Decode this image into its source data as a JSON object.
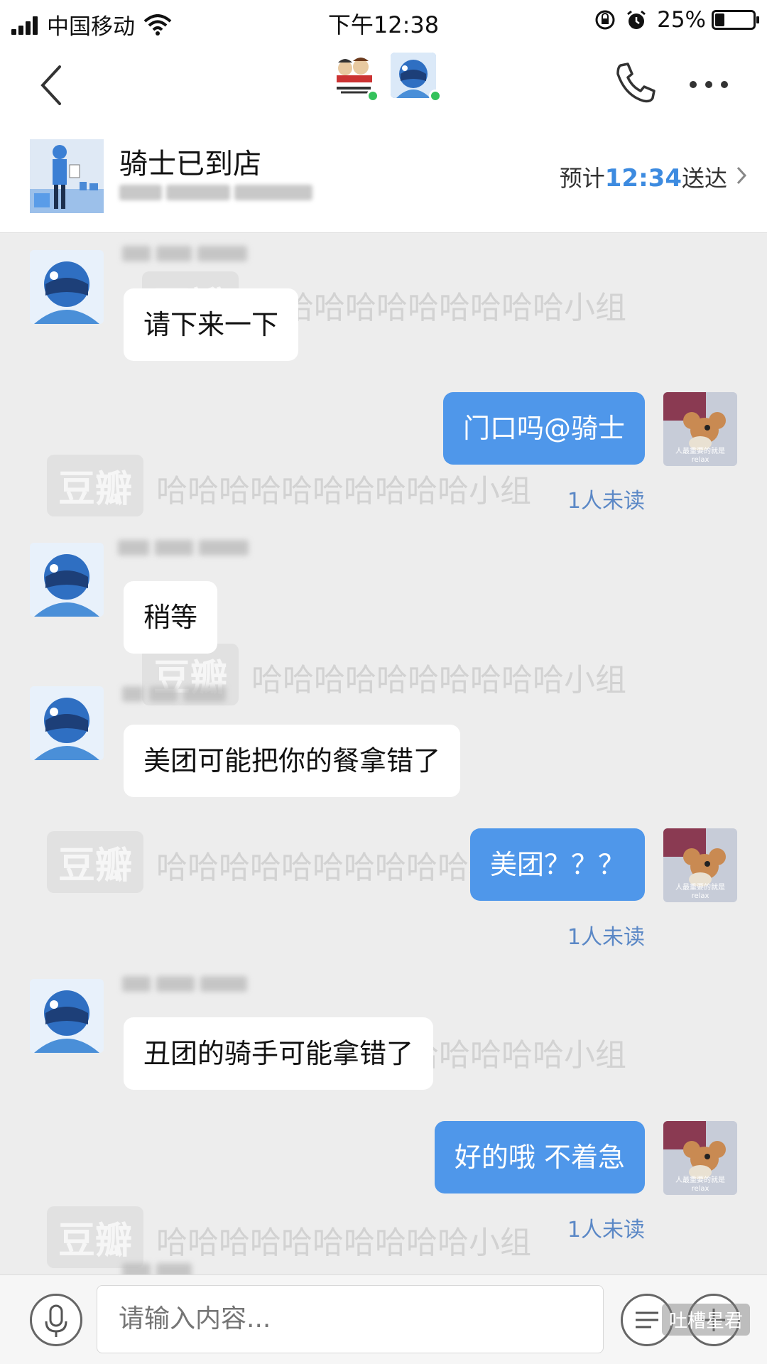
{
  "status_bar": {
    "carrier": "中国移动",
    "time": "下午12:38",
    "battery": "25%",
    "battery_level": 0.25
  },
  "navbar": {
    "back_icon": "chevron-left-icon",
    "call_icon": "phone-icon",
    "more_icon": "more-dots-icon"
  },
  "order": {
    "status_title": "骑士已到店",
    "eta_prefix": "预计",
    "eta_time": "12:34",
    "eta_suffix": "送达"
  },
  "watermark": {
    "logo": "豆瓣",
    "text": "哈哈哈哈哈哈哈哈哈哈小组"
  },
  "messages": [
    {
      "direction": "in",
      "text": "请下来一下"
    },
    {
      "direction": "out",
      "text": "门口吗@骑士",
      "status": "1人未读"
    },
    {
      "direction": "in",
      "text": "稍等"
    },
    {
      "direction": "in",
      "text": "美团可能把你的餐拿错了"
    },
    {
      "direction": "out",
      "text": "美团？？？",
      "status": "1人未读"
    },
    {
      "direction": "in",
      "text": "丑团的骑手可能拿错了"
    },
    {
      "direction": "out",
      "text": "好的哦 不着急",
      "status": "1人未读"
    }
  ],
  "my_avatar_caption": [
    "人最重要的就是",
    "relax"
  ],
  "input": {
    "placeholder": "请输入内容...",
    "voice_icon": "microphone-icon",
    "quick_icon": "quick-reply-icon",
    "plus_icon": "plus-icon"
  },
  "signature": "吐槽星君"
}
